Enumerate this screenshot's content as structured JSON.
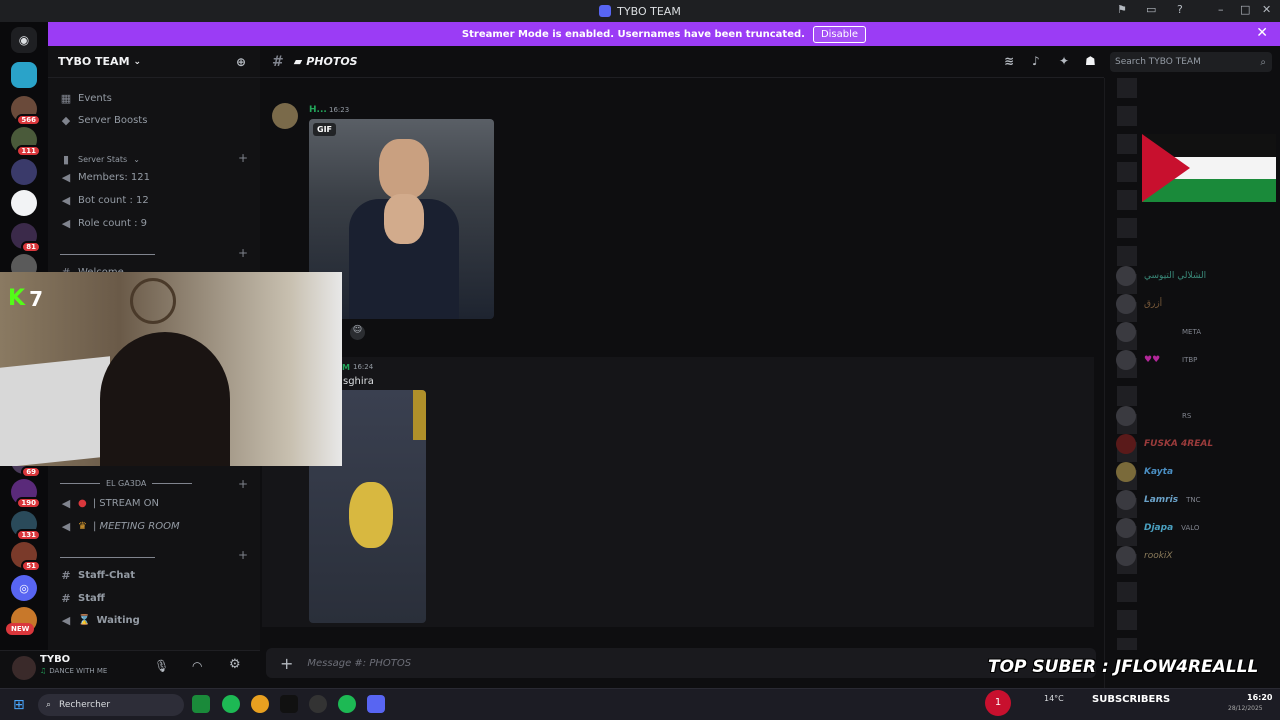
{
  "window": {
    "title": "TYBO TEAM"
  },
  "banner": {
    "text": "Streamer Mode is enabled. Usernames have been truncated.",
    "button": "Disable"
  },
  "server": {
    "name": "TYBO TEAM"
  },
  "channels": {
    "events": "Events",
    "boosts": "Server Boosts",
    "stats_category": "Server Stats",
    "members": "Members: 121",
    "bots": "Bot count : 12",
    "roles": "Role count : 9",
    "welcome": "Welcome",
    "elgasda_category": "EL GA3DA",
    "stream_on": "| STREAM ON",
    "meeting_room": "| MEETING ROOM",
    "staff_chat": "Staff-Chat",
    "staff": "Staff",
    "waiting": "Waiting"
  },
  "server_badges": [
    "566",
    "111",
    "81",
    "69",
    "190",
    "131",
    "51"
  ],
  "new_label": "NEW",
  "user": {
    "name": "TYBO",
    "status": "DANCE WITH ME"
  },
  "channel_header": {
    "name": "PHOTOS"
  },
  "search": {
    "placeholder": "Search TYBO TEAM"
  },
  "messages": [
    {
      "author": "H...",
      "time": "16:23",
      "gif_label": "GIF"
    },
    {
      "author": "M",
      "time": "16:24",
      "text": "sghira"
    }
  ],
  "composer": {
    "placeholder": "Message #: PHOTOS"
  },
  "members": [
    {
      "name": "FUSKA 4REAL",
      "color": "#9b3b3b"
    },
    {
      "name": "Kayta",
      "color": "#4a8ec2"
    },
    {
      "name": "Lamris",
      "tag": "TNC",
      "color": "#6aa2c9"
    },
    {
      "name": "Djapa",
      "tag": "VALO",
      "color": "#4aa0c0"
    },
    {
      "name": "rookiX",
      "color": "#8a7a5a"
    }
  ],
  "member_tags": [
    "META",
    "ITBP",
    "RS"
  ],
  "member_arabic": [
    "الشلالي التيوسي",
    "أزرق"
  ],
  "webcam": {
    "number": "7"
  },
  "overlay": {
    "top_suber": "TOP SUBER : JFLOW4REALLL",
    "subscribers": "SUBSCRIBERS"
  },
  "taskbar": {
    "search": "Rechercher",
    "weather": "14°C",
    "notif": "1",
    "time": "16:20",
    "date": "28/12/2025"
  },
  "colors": {
    "accent": "#5865f2",
    "banner": "#9b3cf5",
    "online": "#23a55a"
  }
}
